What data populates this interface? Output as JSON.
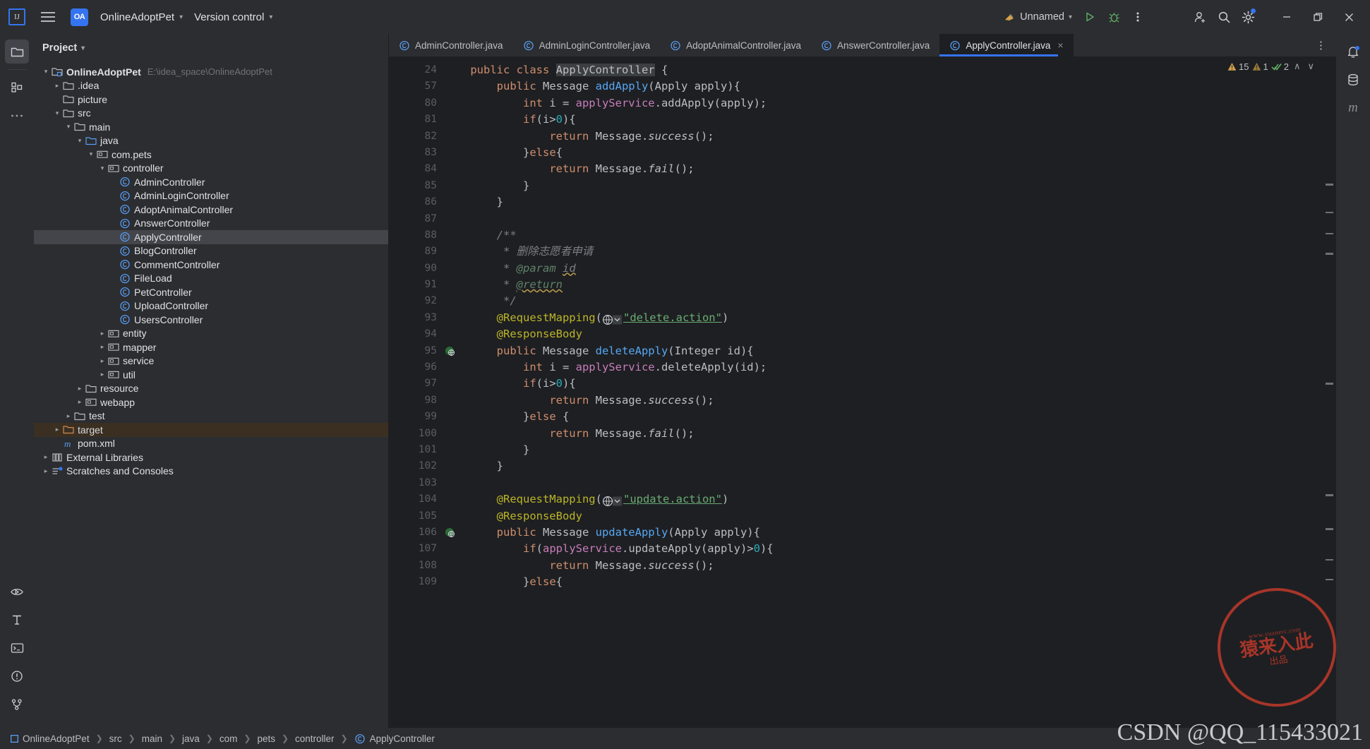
{
  "titlebar": {
    "logo_label": "IJ",
    "project_badge": "OA",
    "project_name": "OnlineAdoptPet",
    "vcs_label": "Version control",
    "run_config": "Unnamed",
    "icons": {
      "menu": "hamburger-icon",
      "run": "run-icon",
      "debug": "debug-icon",
      "more": "more-vertical-icon",
      "add_user": "add-user-icon",
      "search": "search-icon",
      "settings": "settings-icon",
      "minimize": "minimize-icon",
      "maximize": "maximize-icon",
      "close": "close-icon"
    }
  },
  "left_rail": {
    "top": [
      "project-icon",
      "structure-icon",
      "more-tool-windows-icon"
    ],
    "bottom": [
      "run-tool-icon",
      "build-icon",
      "terminal-icon",
      "problems-icon",
      "version-control-icon"
    ]
  },
  "right_rail": {
    "items": [
      "notifications-icon",
      "database-icon",
      "maven-icon"
    ],
    "maven_label": "m"
  },
  "project_panel": {
    "title": "Project",
    "tree": [
      {
        "depth": 0,
        "arrow": "down",
        "icon": "module",
        "label": "OnlineAdoptPet",
        "bold": true,
        "path": "E:\\idea_space\\OnlineAdoptPet"
      },
      {
        "depth": 1,
        "arrow": "right",
        "icon": "folder",
        "label": ".idea"
      },
      {
        "depth": 1,
        "arrow": "none",
        "icon": "folder",
        "label": "picture"
      },
      {
        "depth": 1,
        "arrow": "down",
        "icon": "folder",
        "label": "src"
      },
      {
        "depth": 2,
        "arrow": "down",
        "icon": "folder",
        "label": "main"
      },
      {
        "depth": 3,
        "arrow": "down",
        "icon": "source",
        "label": "java"
      },
      {
        "depth": 4,
        "arrow": "down",
        "icon": "package",
        "label": "com.pets"
      },
      {
        "depth": 5,
        "arrow": "down",
        "icon": "package",
        "label": "controller"
      },
      {
        "depth": 6,
        "arrow": "none",
        "icon": "class",
        "label": "AdminController"
      },
      {
        "depth": 6,
        "arrow": "none",
        "icon": "class",
        "label": "AdminLoginController"
      },
      {
        "depth": 6,
        "arrow": "none",
        "icon": "class",
        "label": "AdoptAnimalController"
      },
      {
        "depth": 6,
        "arrow": "none",
        "icon": "class",
        "label": "AnswerController"
      },
      {
        "depth": 6,
        "arrow": "none",
        "icon": "class",
        "label": "ApplyController",
        "selected": true
      },
      {
        "depth": 6,
        "arrow": "none",
        "icon": "class",
        "label": "BlogController"
      },
      {
        "depth": 6,
        "arrow": "none",
        "icon": "class",
        "label": "CommentController"
      },
      {
        "depth": 6,
        "arrow": "none",
        "icon": "class",
        "label": "FileLoad"
      },
      {
        "depth": 6,
        "arrow": "none",
        "icon": "class",
        "label": "PetController"
      },
      {
        "depth": 6,
        "arrow": "none",
        "icon": "class",
        "label": "UploadController"
      },
      {
        "depth": 6,
        "arrow": "none",
        "icon": "class",
        "label": "UsersController"
      },
      {
        "depth": 5,
        "arrow": "right",
        "icon": "package",
        "label": "entity"
      },
      {
        "depth": 5,
        "arrow": "right",
        "icon": "package",
        "label": "mapper"
      },
      {
        "depth": 5,
        "arrow": "right",
        "icon": "package",
        "label": "service"
      },
      {
        "depth": 5,
        "arrow": "right",
        "icon": "package",
        "label": "util"
      },
      {
        "depth": 3,
        "arrow": "right",
        "icon": "folder",
        "label": "resource"
      },
      {
        "depth": 3,
        "arrow": "right",
        "icon": "package",
        "label": "webapp"
      },
      {
        "depth": 2,
        "arrow": "right",
        "icon": "folder",
        "label": "test"
      },
      {
        "depth": 1,
        "arrow": "right",
        "icon": "excluded",
        "label": "target",
        "excluded": true
      },
      {
        "depth": 1,
        "arrow": "none",
        "icon": "maven",
        "label": "pom.xml"
      },
      {
        "depth": 0,
        "arrow": "right",
        "icon": "library",
        "label": "External Libraries"
      },
      {
        "depth": 0,
        "arrow": "right",
        "icon": "scratch",
        "label": "Scratches and Consoles"
      }
    ]
  },
  "tabs": [
    {
      "label": "AdminController.java",
      "active": false
    },
    {
      "label": "AdminLoginController.java",
      "active": false
    },
    {
      "label": "AdoptAnimalController.java",
      "active": false
    },
    {
      "label": "AnswerController.java",
      "active": false
    },
    {
      "label": "ApplyController.java",
      "active": true
    }
  ],
  "inspections": {
    "warnings": "15",
    "weak_warnings": "1",
    "typos": "2",
    "up_label": "∧",
    "down_label": "∨"
  },
  "editor": {
    "lines": [
      {
        "num": "24",
        "indent": 1,
        "marker": "",
        "tokens": [
          {
            "t": "public ",
            "c": "k"
          },
          {
            "t": "class ",
            "c": "k"
          },
          {
            "t": "ApplyController",
            "c": "t hl-class"
          },
          {
            "t": " {",
            "c": "t"
          }
        ]
      },
      {
        "num": "57",
        "indent": 2,
        "marker": "",
        "tokens": [
          {
            "t": "public ",
            "c": "k"
          },
          {
            "t": "Message ",
            "c": "t"
          },
          {
            "t": "addApply",
            "c": "m"
          },
          {
            "t": "(Apply apply){",
            "c": "t"
          }
        ]
      },
      {
        "num": "80",
        "indent": 3,
        "marker": "",
        "tokens": [
          {
            "t": "int ",
            "c": "k"
          },
          {
            "t": "i = ",
            "c": "t"
          },
          {
            "t": "applyService",
            "c": "f"
          },
          {
            "t": ".addApply(apply);",
            "c": "t"
          }
        ]
      },
      {
        "num": "81",
        "indent": 3,
        "marker": "",
        "tokens": [
          {
            "t": "if",
            "c": "k"
          },
          {
            "t": "(i>",
            "c": "t"
          },
          {
            "t": "0",
            "c": "n"
          },
          {
            "t": "){",
            "c": "t"
          }
        ]
      },
      {
        "num": "82",
        "indent": 4,
        "marker": "",
        "tokens": [
          {
            "t": "return ",
            "c": "k"
          },
          {
            "t": "Message.",
            "c": "t"
          },
          {
            "t": "success",
            "c": "t it"
          },
          {
            "t": "();",
            "c": "t"
          }
        ]
      },
      {
        "num": "83",
        "indent": 3,
        "marker": "",
        "tokens": [
          {
            "t": "}",
            "c": "t"
          },
          {
            "t": "else",
            "c": "k"
          },
          {
            "t": "{",
            "c": "t"
          }
        ]
      },
      {
        "num": "84",
        "indent": 4,
        "marker": "",
        "tokens": [
          {
            "t": "return ",
            "c": "k"
          },
          {
            "t": "Message.",
            "c": "t"
          },
          {
            "t": "fail",
            "c": "t it"
          },
          {
            "t": "();",
            "c": "t"
          }
        ]
      },
      {
        "num": "85",
        "indent": 3,
        "marker": "",
        "tokens": [
          {
            "t": "}",
            "c": "t"
          }
        ]
      },
      {
        "num": "86",
        "indent": 2,
        "marker": "",
        "tokens": [
          {
            "t": "}",
            "c": "t"
          }
        ]
      },
      {
        "num": "87",
        "indent": 0,
        "marker": "",
        "tokens": []
      },
      {
        "num": "88",
        "indent": 2,
        "marker": "",
        "tokens": [
          {
            "t": "/**",
            "c": "cm"
          }
        ]
      },
      {
        "num": "89",
        "indent": 2,
        "marker": "",
        "tokens": [
          {
            "t": " * 删除志愿者申请",
            "c": "cm"
          }
        ]
      },
      {
        "num": "90",
        "indent": 2,
        "marker": "",
        "tokens": [
          {
            "t": " * ",
            "c": "cm"
          },
          {
            "t": "@param",
            "c": "jd"
          },
          {
            "t": " ",
            "c": "cm"
          },
          {
            "t": "id",
            "c": "cm squiggle"
          }
        ]
      },
      {
        "num": "91",
        "indent": 2,
        "marker": "",
        "tokens": [
          {
            "t": " * ",
            "c": "cm"
          },
          {
            "t": "@return",
            "c": "jd squiggle"
          }
        ]
      },
      {
        "num": "92",
        "indent": 2,
        "marker": "",
        "tokens": [
          {
            "t": " */",
            "c": "cm"
          }
        ]
      },
      {
        "num": "93",
        "indent": 2,
        "marker": "",
        "globe": true,
        "tokens": [
          {
            "t": "@RequestMapping",
            "c": "an"
          },
          {
            "t": "(",
            "c": "t"
          },
          {
            "t": "__GLOBE__",
            "c": "t"
          },
          {
            "t": "\"delete.action\"",
            "c": "s underline-str"
          },
          {
            "t": ")",
            "c": "t"
          }
        ]
      },
      {
        "num": "94",
        "indent": 2,
        "marker": "",
        "tokens": [
          {
            "t": "@ResponseBody",
            "c": "an"
          }
        ]
      },
      {
        "num": "95",
        "indent": 2,
        "marker": "web",
        "tokens": [
          {
            "t": "public ",
            "c": "k"
          },
          {
            "t": "Message ",
            "c": "t"
          },
          {
            "t": "deleteApply",
            "c": "m"
          },
          {
            "t": "(Integer id){",
            "c": "t"
          }
        ]
      },
      {
        "num": "96",
        "indent": 3,
        "marker": "",
        "tokens": [
          {
            "t": "int ",
            "c": "k"
          },
          {
            "t": "i = ",
            "c": "t"
          },
          {
            "t": "applyService",
            "c": "f"
          },
          {
            "t": ".deleteApply(id);",
            "c": "t"
          }
        ]
      },
      {
        "num": "97",
        "indent": 3,
        "marker": "",
        "tokens": [
          {
            "t": "if",
            "c": "k"
          },
          {
            "t": "(i>",
            "c": "t"
          },
          {
            "t": "0",
            "c": "n"
          },
          {
            "t": "){",
            "c": "t"
          }
        ]
      },
      {
        "num": "98",
        "indent": 4,
        "marker": "",
        "tokens": [
          {
            "t": "return ",
            "c": "k"
          },
          {
            "t": "Message.",
            "c": "t"
          },
          {
            "t": "success",
            "c": "t it"
          },
          {
            "t": "();",
            "c": "t"
          }
        ]
      },
      {
        "num": "99",
        "indent": 3,
        "marker": "",
        "tokens": [
          {
            "t": "}",
            "c": "t"
          },
          {
            "t": "else",
            "c": "k"
          },
          {
            "t": " {",
            "c": "t"
          }
        ]
      },
      {
        "num": "100",
        "indent": 4,
        "marker": "",
        "tokens": [
          {
            "t": "return ",
            "c": "k"
          },
          {
            "t": "Message.",
            "c": "t"
          },
          {
            "t": "fail",
            "c": "t it"
          },
          {
            "t": "();",
            "c": "t"
          }
        ]
      },
      {
        "num": "101",
        "indent": 3,
        "marker": "",
        "tokens": [
          {
            "t": "}",
            "c": "t"
          }
        ]
      },
      {
        "num": "102",
        "indent": 2,
        "marker": "",
        "tokens": [
          {
            "t": "}",
            "c": "t"
          }
        ]
      },
      {
        "num": "103",
        "indent": 0,
        "marker": "",
        "tokens": []
      },
      {
        "num": "104",
        "indent": 2,
        "marker": "",
        "globe": true,
        "tokens": [
          {
            "t": "@RequestMapping",
            "c": "an"
          },
          {
            "t": "(",
            "c": "t"
          },
          {
            "t": "__GLOBE__",
            "c": "t"
          },
          {
            "t": "\"update.action\"",
            "c": "s underline-str"
          },
          {
            "t": ")",
            "c": "t"
          }
        ]
      },
      {
        "num": "105",
        "indent": 2,
        "marker": "",
        "tokens": [
          {
            "t": "@ResponseBody",
            "c": "an"
          }
        ]
      },
      {
        "num": "106",
        "indent": 2,
        "marker": "web",
        "tokens": [
          {
            "t": "public ",
            "c": "k"
          },
          {
            "t": "Message ",
            "c": "t"
          },
          {
            "t": "updateApply",
            "c": "m"
          },
          {
            "t": "(Apply apply){",
            "c": "t"
          }
        ]
      },
      {
        "num": "107",
        "indent": 3,
        "marker": "",
        "tokens": [
          {
            "t": "if",
            "c": "k"
          },
          {
            "t": "(",
            "c": "t"
          },
          {
            "t": "applyService",
            "c": "f"
          },
          {
            "t": ".updateApply(apply)>",
            "c": "t"
          },
          {
            "t": "0",
            "c": "n"
          },
          {
            "t": "){",
            "c": "t"
          }
        ]
      },
      {
        "num": "108",
        "indent": 4,
        "marker": "",
        "tokens": [
          {
            "t": "return ",
            "c": "k"
          },
          {
            "t": "Message.",
            "c": "t"
          },
          {
            "t": "success",
            "c": "t it"
          },
          {
            "t": "();",
            "c": "t"
          }
        ]
      },
      {
        "num": "109",
        "indent": 3,
        "marker": "",
        "tokens": [
          {
            "t": "}",
            "c": "t"
          },
          {
            "t": "else",
            "c": "k"
          },
          {
            "t": "{",
            "c": "t"
          }
        ]
      }
    ]
  },
  "breadcrumb": [
    {
      "label": "OnlineAdoptPet",
      "icon": "module"
    },
    {
      "label": "src"
    },
    {
      "label": "main"
    },
    {
      "label": "java"
    },
    {
      "label": "com"
    },
    {
      "label": "pets"
    },
    {
      "label": "controller"
    },
    {
      "label": "ApplyController",
      "icon": "class"
    }
  ],
  "watermark": {
    "stamp_top": "www.yuanerc.com",
    "stamp_mid": "猿来入此",
    "stamp_bot": "出品",
    "csdn": "CSDN @QQ_115433021"
  },
  "colors": {
    "accent": "#3574f0",
    "bg_editor": "#1e1f22",
    "bg_panel": "#2b2d30",
    "selection": "#43454a",
    "excluded": "#3b2f22",
    "keyword": "#cf8e6d",
    "string": "#6aab73",
    "annotation": "#bbb529",
    "method": "#56a8f5",
    "field": "#c77dbb",
    "number": "#2aacb8",
    "comment": "#7a7e85"
  }
}
